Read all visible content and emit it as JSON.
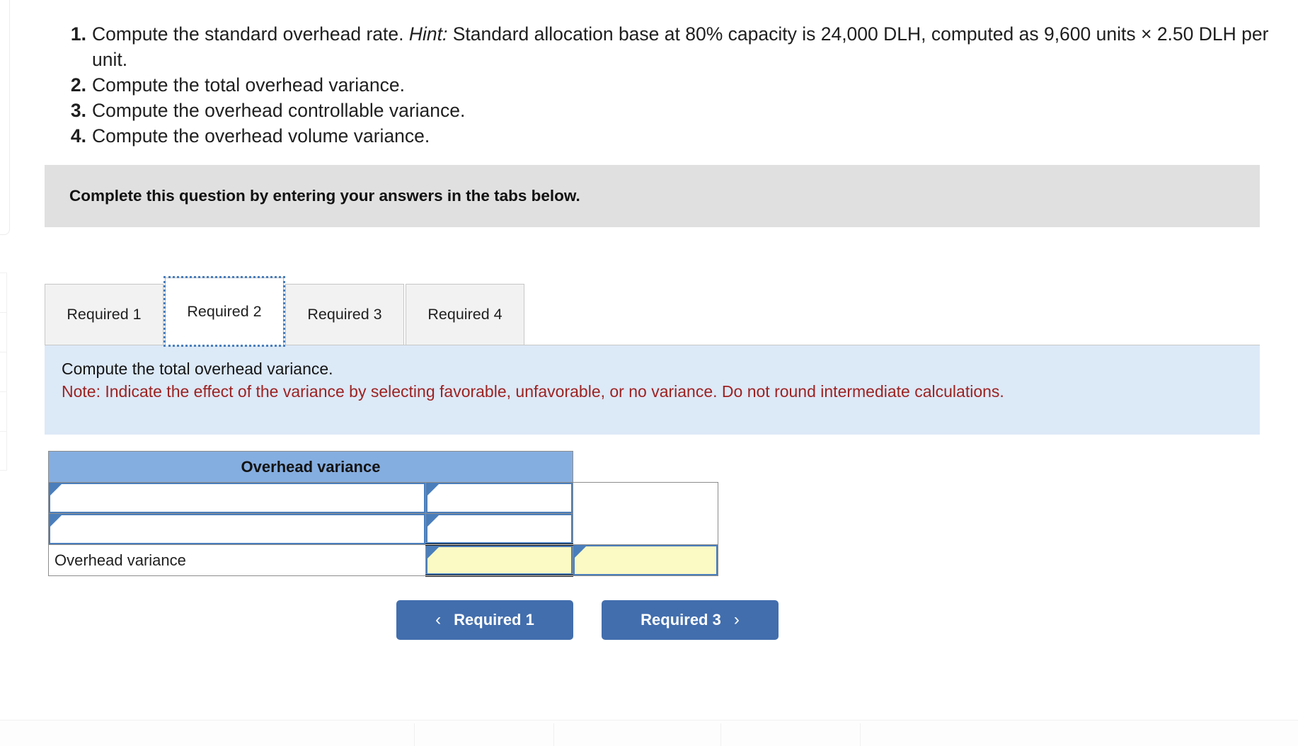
{
  "questions": [
    {
      "num": "1.",
      "text": "Compute the standard overhead rate. ",
      "hint": "Hint:",
      "text_after": " Standard allocation base at 80% capacity is 24,000 DLH, computed as 9,600 units × 2.50 DLH per unit."
    },
    {
      "num": "2.",
      "text": "Compute the total overhead variance.",
      "hint": "",
      "text_after": ""
    },
    {
      "num": "3.",
      "text": "Compute the overhead controllable variance.",
      "hint": "",
      "text_after": ""
    },
    {
      "num": "4.",
      "text": "Compute the overhead volume variance.",
      "hint": "",
      "text_after": ""
    }
  ],
  "banner": {
    "text": "Complete this question by entering your answers in the tabs below."
  },
  "tabs": [
    {
      "label": "Required 1",
      "active": false
    },
    {
      "label": "Required 2",
      "active": true
    },
    {
      "label": "Required 3",
      "active": false
    },
    {
      "label": "Required 4",
      "active": false
    }
  ],
  "info": {
    "instruction": "Compute the total overhead variance.",
    "note": "Note: Indicate the effect of the variance by selecting favorable, unfavorable, or no variance. Do not round intermediate calculations."
  },
  "answer_table": {
    "header": "Overhead variance",
    "rows": [
      {
        "label": "",
        "value": "",
        "effect": "",
        "type": "input"
      },
      {
        "label": "",
        "value": "",
        "effect": "",
        "type": "input"
      },
      {
        "label": "Overhead variance",
        "value": "",
        "effect": "",
        "type": "total"
      }
    ]
  },
  "nav": {
    "prev_label": "Required 1",
    "next_label": "Required 3",
    "prev_icon": "chevron-left",
    "next_icon": "chevron-right"
  },
  "colors": {
    "table_header_blue": "#85aee0",
    "input_border_blue": "#4a7ebb",
    "highlight_yellow": "#fbf9c4",
    "info_panel_blue": "#dce9f7",
    "note_red": "#9d2222",
    "banner_gray": "#e0e0e0",
    "button_blue": "#426ead"
  }
}
